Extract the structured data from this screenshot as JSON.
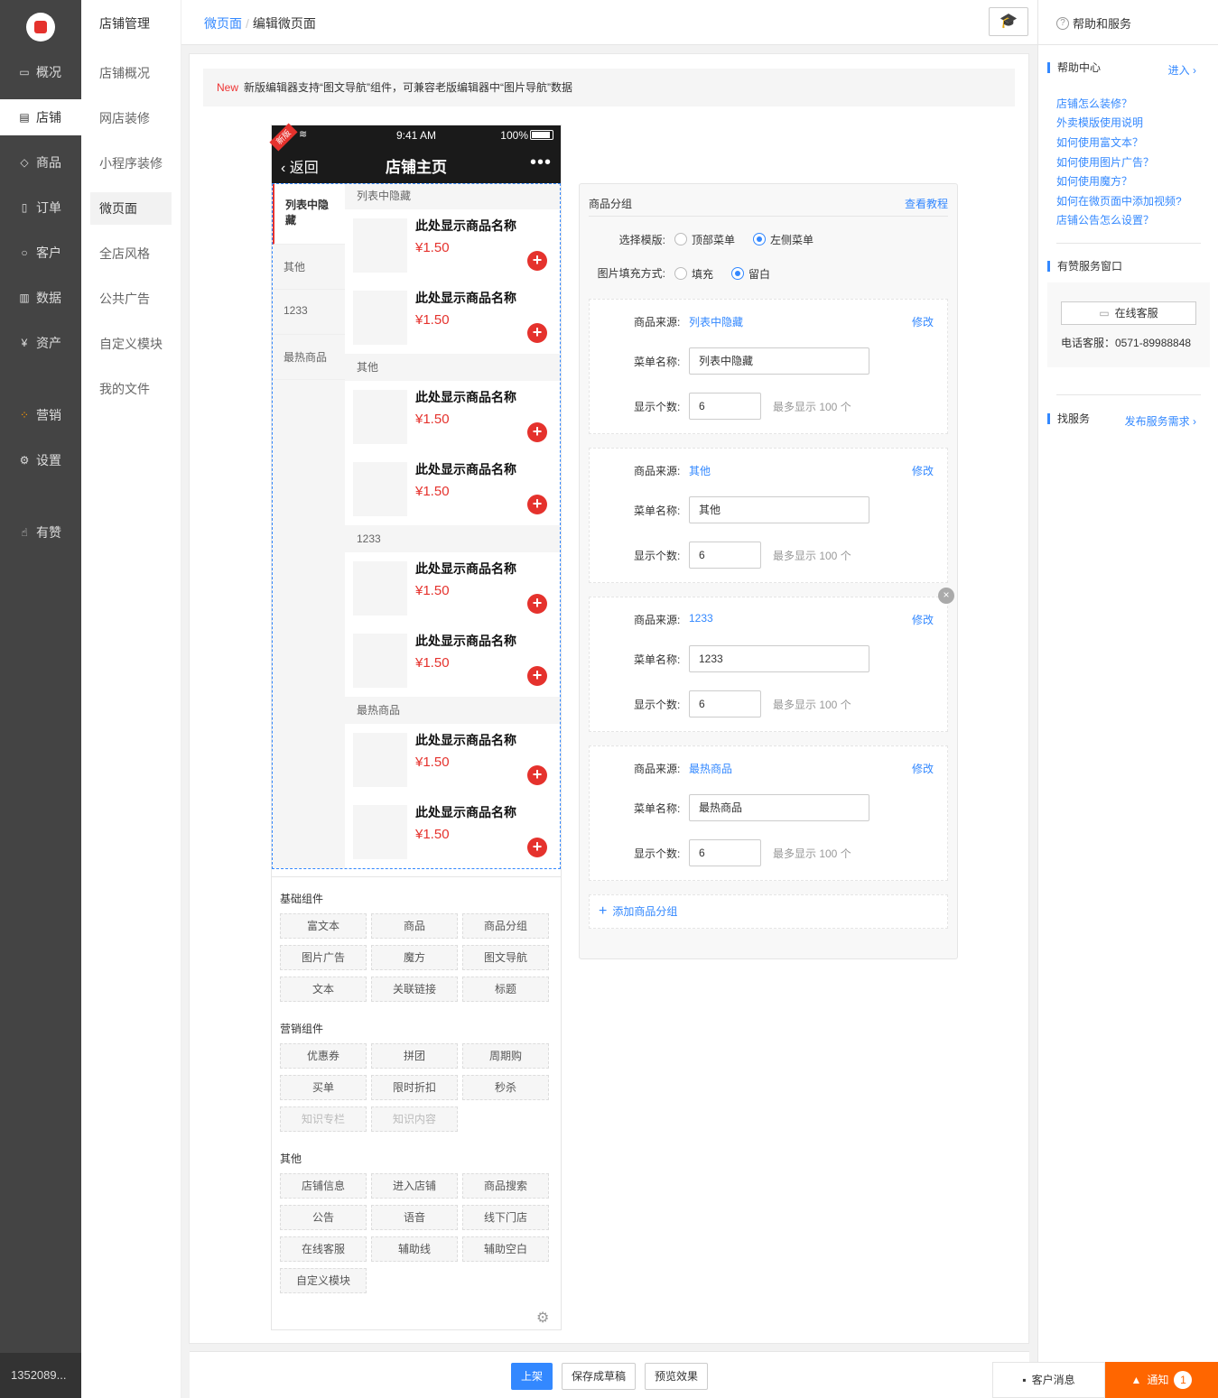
{
  "nav1": {
    "items": [
      {
        "label": "概况",
        "icon": "monitor-icon"
      },
      {
        "label": "店铺",
        "icon": "store-icon"
      },
      {
        "label": "商品",
        "icon": "tag-icon"
      },
      {
        "label": "订单",
        "icon": "document-icon"
      },
      {
        "label": "客户",
        "icon": "user-icon"
      },
      {
        "label": "数据",
        "icon": "bar-chart-icon"
      },
      {
        "label": "资产",
        "icon": "yen-icon"
      },
      {
        "label": "营销",
        "icon": "apps-icon"
      },
      {
        "label": "设置",
        "icon": "gear-icon"
      },
      {
        "label": "有赞",
        "icon": "thumbs-up-icon"
      }
    ],
    "user": "1352089..."
  },
  "nav2": {
    "title": "店铺管理",
    "items": [
      "店铺概况",
      "网店装修",
      "小程序装修",
      "微页面",
      "全店风格",
      "公共广告",
      "自定义模块",
      "我的文件"
    ]
  },
  "header": {
    "crumb_link": "微页面",
    "crumb_sep": "/",
    "crumb_current": "编辑微页面"
  },
  "notice": {
    "badge": "New",
    "text": "新版编辑器支持“图文导航”组件，可兼容老版编辑器中“图片导航”数据"
  },
  "phone": {
    "ribbon": "新版",
    "time": "9:41 AM",
    "battery": "100%",
    "back": "返回",
    "title": "店铺主页",
    "more": "•••",
    "menu": [
      "列表中隐藏",
      "其他",
      "1233",
      "最热商品"
    ],
    "groups": [
      "列表中隐藏",
      "其他",
      "1233",
      "最热商品"
    ],
    "product_name": "此处显示商品名称",
    "product_price": "¥1.50",
    "add": "+"
  },
  "components": {
    "basic_title": "基础组件",
    "basic": [
      "富文本",
      "商品",
      "商品分组",
      "图片广告",
      "魔方",
      "图文导航",
      "文本",
      "关联链接",
      "标题"
    ],
    "marketing_title": "营销组件",
    "marketing": [
      "优惠券",
      "拼团",
      "周期购",
      "买单",
      "限时折扣",
      "秒杀",
      "知识专栏",
      "知识内容"
    ],
    "other_title": "其他",
    "other": [
      "店铺信息",
      "进入店铺",
      "商品搜索",
      "公告",
      "语音",
      "线下门店",
      "在线客服",
      "辅助线",
      "辅助空白",
      "自定义模块"
    ]
  },
  "editor": {
    "title": "商品分组",
    "tutorial": "查看教程",
    "template_label": "选择模版:",
    "template_options": [
      "顶部菜单",
      "左侧菜单"
    ],
    "template_selected": "左侧菜单",
    "fill_label": "图片填充方式:",
    "fill_options": [
      "填充",
      "留白"
    ],
    "fill_selected": "留白",
    "source_label": "商品来源:",
    "menu_label": "菜单名称:",
    "count_label": "显示个数:",
    "edit": "修改",
    "count_hint": "最多显示 100 个",
    "groups": [
      {
        "source": "列表中隐藏",
        "menu": "列表中隐藏",
        "count": "6"
      },
      {
        "source": "其他",
        "menu": "其他",
        "count": "6"
      },
      {
        "source": "1233",
        "menu": "1233",
        "count": "6"
      },
      {
        "source": "最热商品",
        "menu": "最热商品",
        "count": "6"
      }
    ],
    "add_group": "添加商品分组"
  },
  "help": {
    "title": "帮助和服务",
    "center": "帮助中心",
    "enter": "进入",
    "links": [
      "店铺怎么装修？",
      "外卖模版使用说明",
      "如何使用富文本？",
      "如何使用图片广告？",
      "如何使用魔方？",
      "如何在微页面中添加视频?",
      "店铺公告怎么设置？"
    ],
    "service_window": "有赞服务窗口",
    "online_service": "在线客服",
    "phone": "电话客服：0571-89988848",
    "find": "找服务",
    "publish": "发布服务需求"
  },
  "actions": {
    "publish": "上架",
    "save": "保存成草稿",
    "preview": "预览效果"
  },
  "footer": {
    "messages": "客户消息",
    "notify": "通知",
    "notify_count": "1"
  },
  "colors": {
    "accent": "#3388ff",
    "red": "#e5322d",
    "orange": "#ff6600",
    "sidebar": "#444444"
  }
}
